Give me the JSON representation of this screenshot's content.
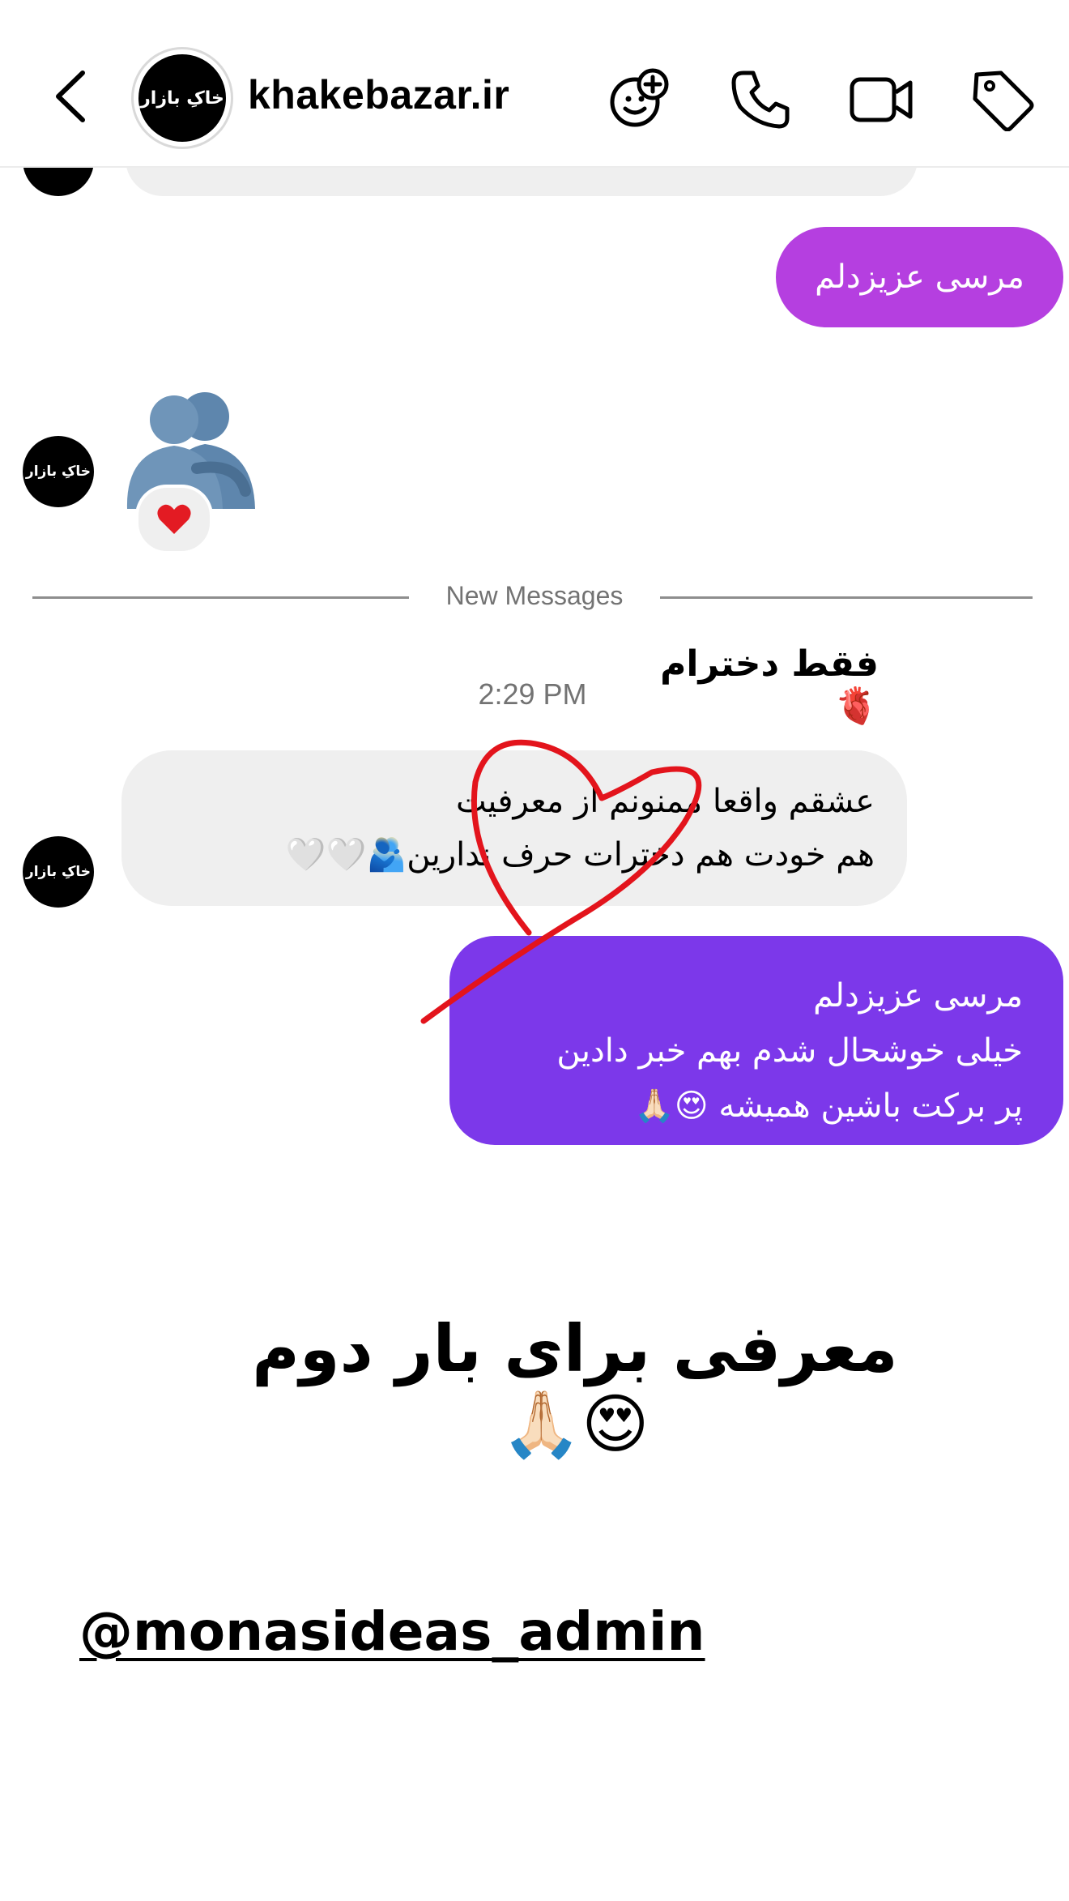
{
  "header": {
    "avatar_text": "خاکِ بازار",
    "username": "khakebazar.ir",
    "icons": [
      "back-icon",
      "sticker-add-icon",
      "phone-icon",
      "video-icon",
      "tag-icon"
    ]
  },
  "avatar_text": "خاکِ بازار",
  "messages": {
    "out_1": "مرسی عزیزدلم",
    "reaction_emoji": "❤️",
    "divider": "New Messages",
    "time": "2:29 PM",
    "overlay_label": "فقط دخترام🫀",
    "in_1_line1": "عشقم واقعا ممنونم از معرفیت",
    "in_1_line2": "هم خودت هم دخترات حرف ندارین🫂🤍🤍",
    "out_2_line1": "مرسی عزیزدلم",
    "out_2_line2": "خیلی خوشحال شدم بهم خبر دادین",
    "out_2_line3": "پر برکت باشین همیشه 😍🙏🏻"
  },
  "caption": "معرفی برای بار دوم 😍🙏🏻",
  "handle": "@monasideas_admin",
  "colors": {
    "out_bubble_1": "#b53fe0",
    "out_bubble_2": "#7c38ea",
    "in_bubble": "#efefef",
    "heart_stroke": "#e3141c",
    "divider": "#8e8e8e"
  }
}
